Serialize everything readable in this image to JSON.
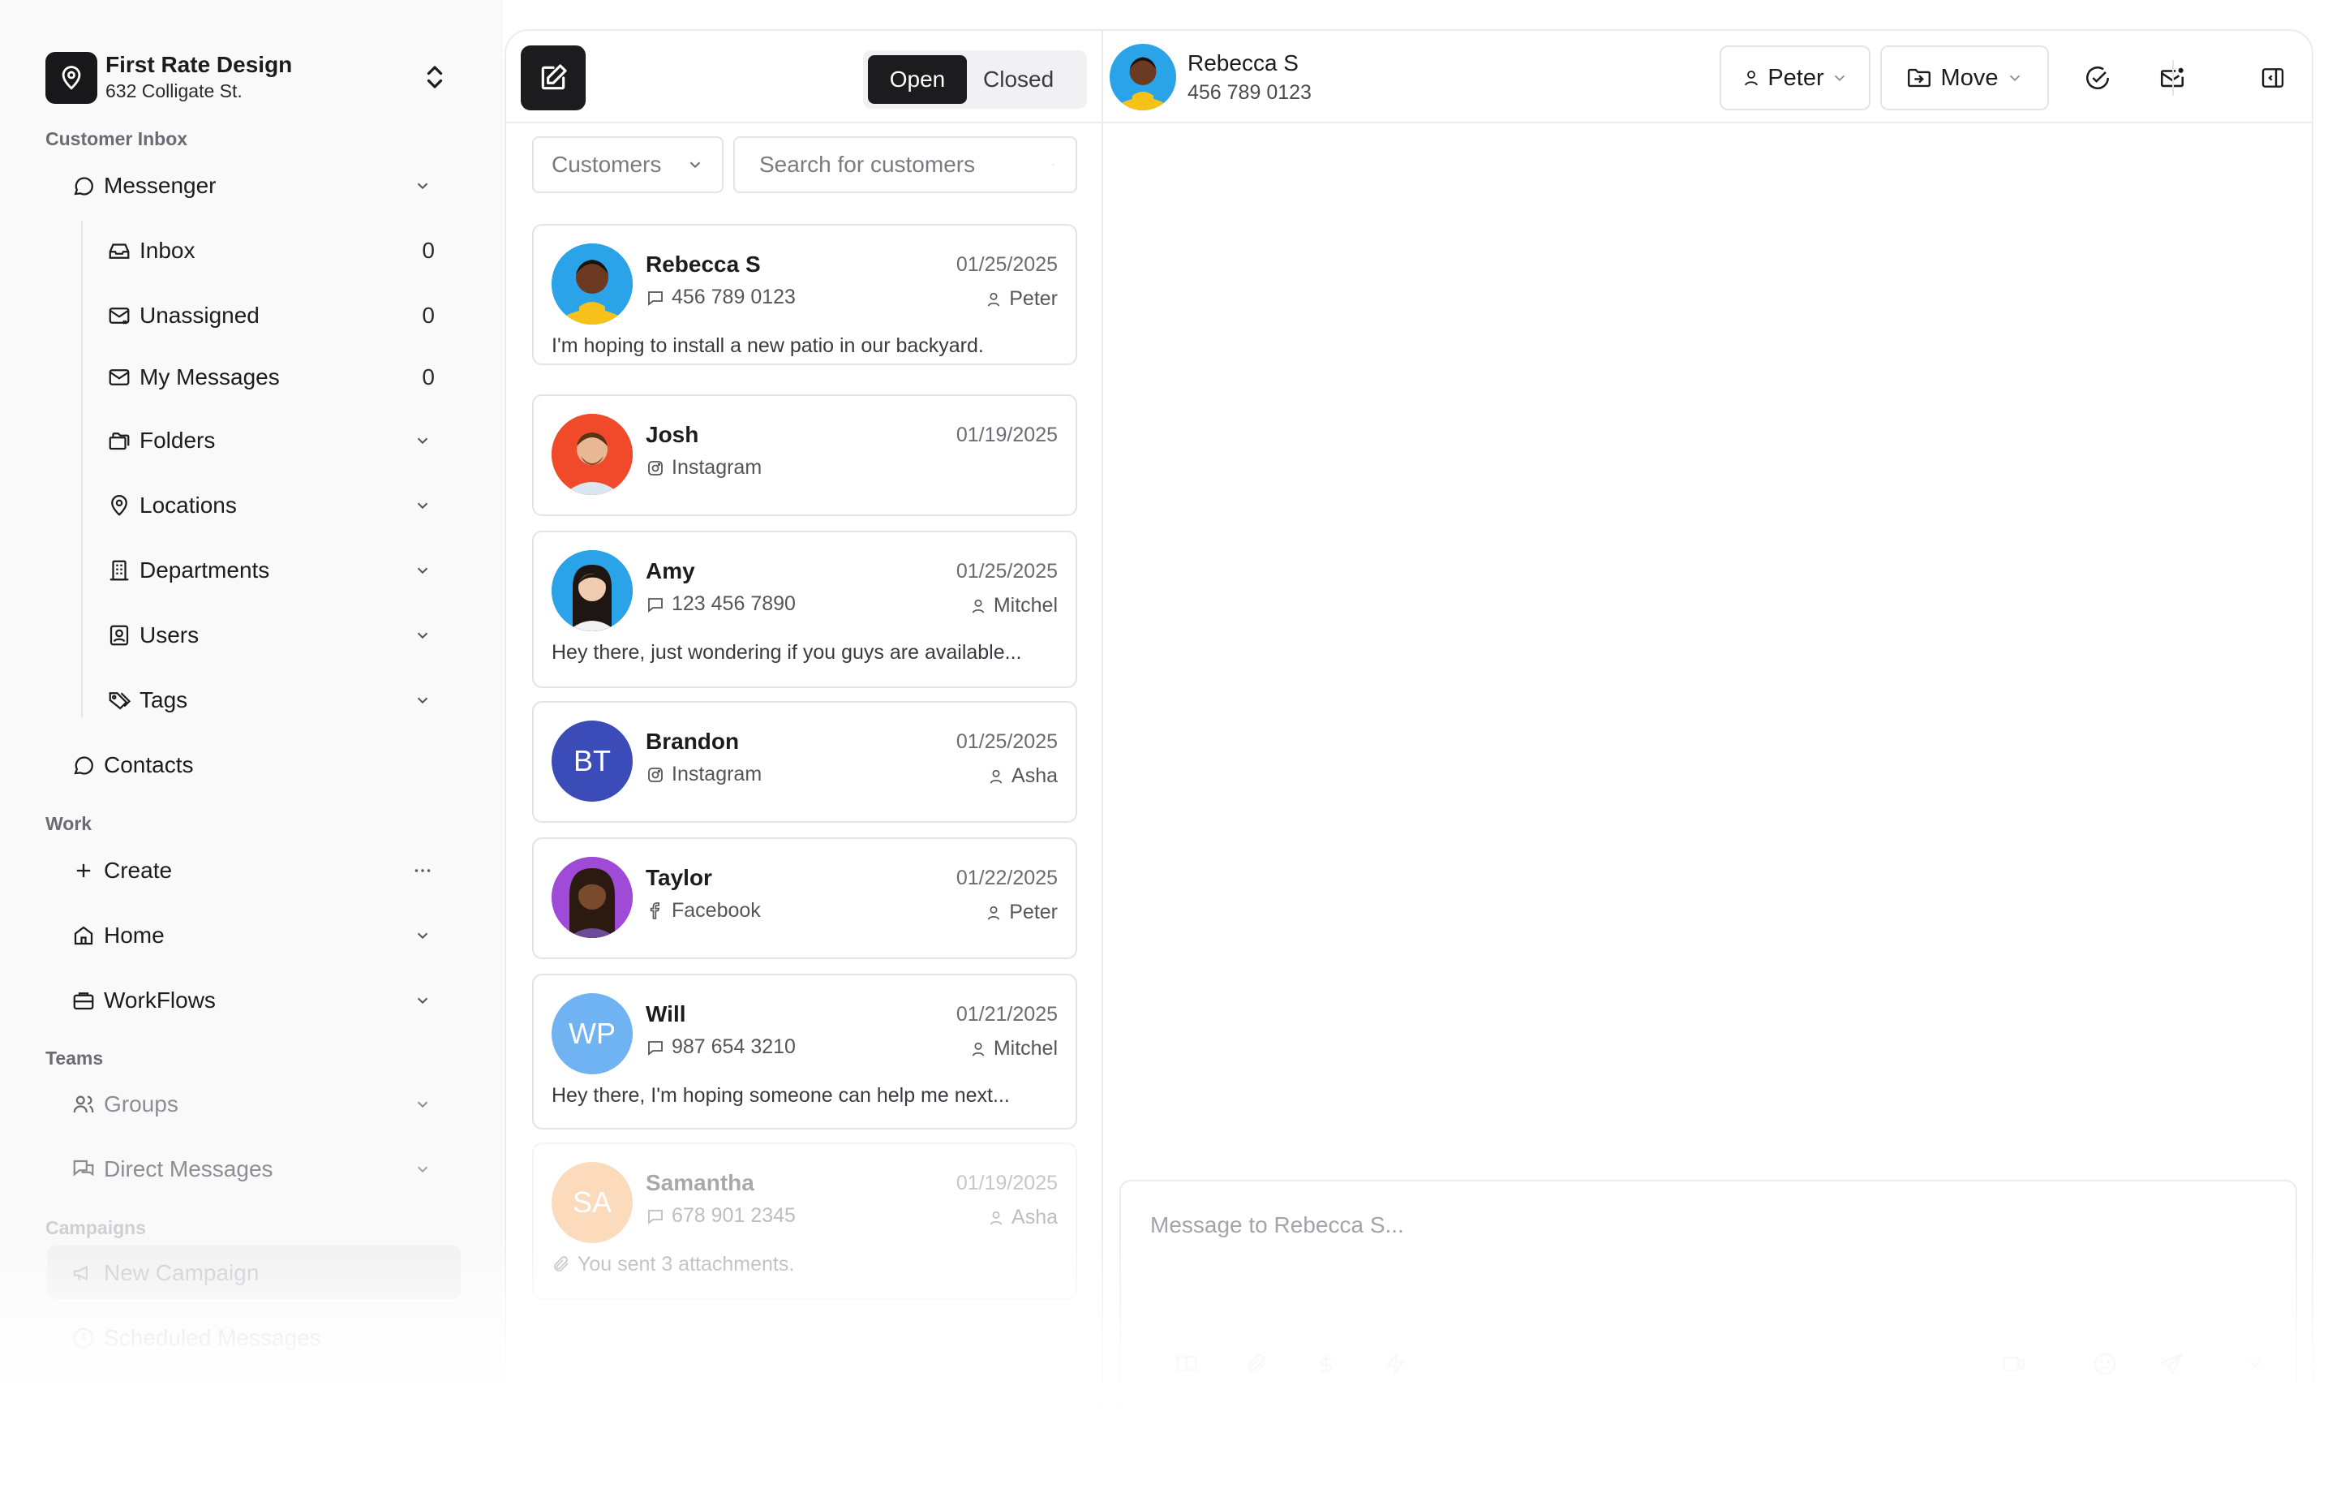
{
  "org": {
    "name": "First Rate Design",
    "address": "632 Colligate St."
  },
  "sidebar": {
    "customer_inbox_label": "Customer Inbox",
    "messenger": "Messenger",
    "inbox": {
      "label": "Inbox",
      "count": "0"
    },
    "unassigned": {
      "label": "Unassigned",
      "count": "0"
    },
    "my_messages": {
      "label": "My Messages",
      "count": "0"
    },
    "folders": "Folders",
    "locations": "Locations",
    "departments": "Departments",
    "users": "Users",
    "tags": "Tags",
    "contacts": "Contacts",
    "work_label": "Work",
    "create": "Create",
    "home": "Home",
    "workflows": "WorkFlows",
    "teams_label": "Teams",
    "groups": "Groups",
    "direct_messages": "Direct Messages",
    "campaigns_label": "Campaigns",
    "new_campaign": "New Campaign",
    "scheduled_messages": "Scheduled Messages"
  },
  "list": {
    "tab_open": "Open",
    "tab_closed": "Closed",
    "filter": "Customers",
    "search_placeholder": "Search for customers",
    "conversations": [
      {
        "name": "Rebecca S",
        "date": "01/25/2025",
        "channel": "456 789 0123",
        "channel_icon": "message-icon",
        "agent": "Peter",
        "preview": "I'm hoping to install a new patio in our backyard."
      },
      {
        "name": "Josh",
        "date": "01/19/2025",
        "channel": "Instagram",
        "channel_icon": "instagram-icon",
        "agent": "",
        "preview": ""
      },
      {
        "name": "Amy",
        "date": "01/25/2025",
        "channel": "123 456 7890",
        "channel_icon": "message-icon",
        "agent": "Mitchel",
        "preview": "Hey there, just wondering if you guys are available..."
      },
      {
        "name": "Brandon",
        "initials": "BT",
        "date": "01/25/2025",
        "channel": "Instagram",
        "channel_icon": "instagram-icon",
        "agent": "Asha",
        "preview": ""
      },
      {
        "name": "Taylor",
        "date": "01/22/2025",
        "channel": "Facebook",
        "channel_icon": "facebook-icon",
        "agent": "Peter",
        "preview": ""
      },
      {
        "name": "Will",
        "initials": "WP",
        "date": "01/21/2025",
        "channel": "987 654 3210",
        "channel_icon": "message-icon",
        "agent": "Mitchel",
        "preview": "Hey there, I'm hoping someone can help me next..."
      },
      {
        "name": "Samantha",
        "initials": "SA",
        "date": "01/19/2025",
        "channel": "678 901 2345",
        "channel_icon": "message-icon",
        "agent": "Asha",
        "preview": "You sent 3 attachments."
      }
    ]
  },
  "conversation": {
    "name": "Rebecca S",
    "phone": "456 789 0123",
    "assignee": "Peter",
    "move_label": "Move",
    "message_placeholder": "Message to Rebecca S..."
  },
  "colors": {
    "primary_dark": "#1c1c1f",
    "brandon_avatar": "#3b4bb8",
    "will_avatar": "#6fb3f2",
    "samantha_avatar": "#f6a351"
  }
}
